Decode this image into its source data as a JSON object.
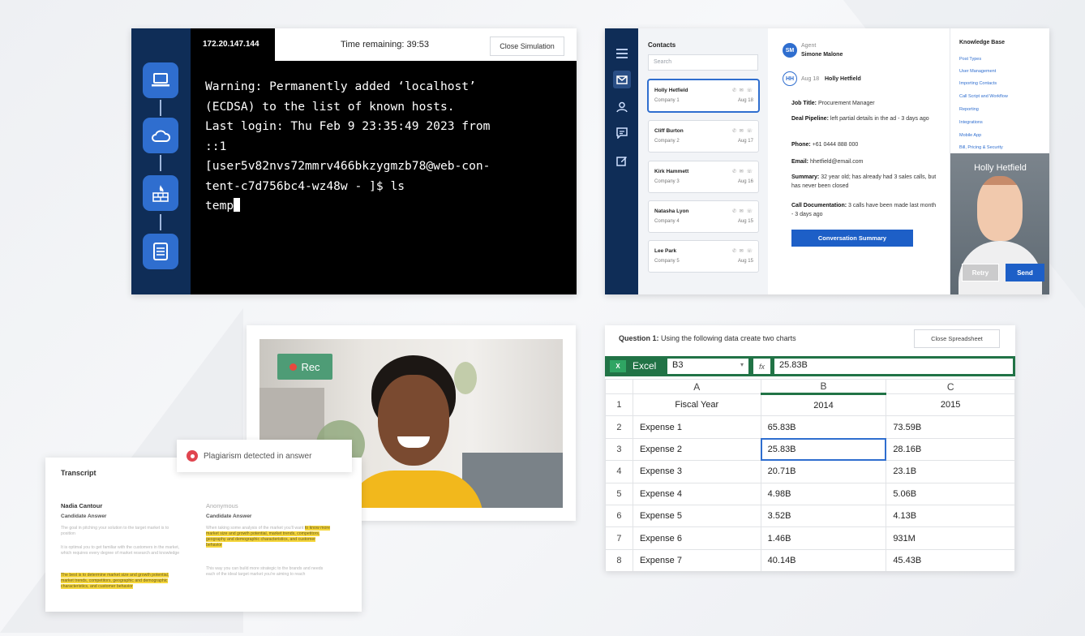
{
  "terminal": {
    "ip": "172.20.147.144",
    "time_remaining": "Time remaining: 39:53",
    "close_label": "Close Simulation",
    "lines": [
      "Warning: Permanently added ‘localhost’",
      "(ECDSA) to the list of known hosts.",
      "Last login: Thu Feb 9 23:35:49 2023 from",
      "::1",
      "[user5v82nvs72mmrv466bkzygmzb78@web-con-",
      "tent-c7d756bc4-wz48w - ]$ ls",
      "temp"
    ],
    "sidebar_icons": [
      "laptop-icon",
      "cloud-icon",
      "firewall-icon",
      "server-icon"
    ]
  },
  "crm": {
    "contacts_title": "Contacts",
    "search_placeholder": "Search",
    "contacts": [
      {
        "name": "Holly Hetfield",
        "company": "Company 1",
        "date": "Aug 18"
      },
      {
        "name": "Cliff Burton",
        "company": "Company 2",
        "date": "Aug 17"
      },
      {
        "name": "Kirk Hammett",
        "company": "Company 3",
        "date": "Aug 16"
      },
      {
        "name": "Natasha Lyon",
        "company": "Company 4",
        "date": "Aug 15"
      },
      {
        "name": "Lee Park",
        "company": "Company 5",
        "date": "Aug 15"
      }
    ],
    "agent_label": "Agent",
    "agent_name": "Simone Malone",
    "agent_initials": "SM",
    "contact_initials": "HH",
    "thread_date": "Aug 18",
    "thread_name": "Holly Hetfield",
    "job_title_label": "Job Title:",
    "job_title": "Procurement Manager",
    "deal_label": "Deal Pipeline:",
    "deal": "left partial details in the ad - 3 days ago",
    "phone_label": "Phone:",
    "phone": "+61 0444 888 000",
    "email_label": "Email:",
    "email": "hhetfield@email.com",
    "summary_label": "Summary:",
    "summary": "32 year old; has already had 3 sales calls, but has never been closed",
    "calldoc_label": "Call Documentation:",
    "calldoc": "3 calls have been made last month - 3 days ago",
    "conversation_button": "Conversation Summary",
    "kb_title": "Knowledge Base",
    "kb_links": [
      "Post Types",
      "User Management",
      "Importing Contacts",
      "Call Script and Workflow",
      "Reporting",
      "Integrations",
      "Mobile App",
      "Bill, Pricing & Security"
    ],
    "video_name": "Holly Hetfield",
    "retry": "Retry",
    "send": "Send"
  },
  "video": {
    "rec_label": "Rec"
  },
  "transcript": {
    "title": "Transcript",
    "left_name": "Nadia Cantour",
    "left_sub": "Candidate Answer",
    "left_p1": "The goal in pitching your solution to the target market is to position",
    "left_p2": "It is optimal you to get familiar with the customers in the market, which requires every degree of market research and knowledge",
    "left_hl": "The best is to determine market size and growth potential, market trends, competitors, geographic and demographic characteristics, and customer behavior",
    "right_name": "Anonymous",
    "right_sub": "Candidate Answer",
    "right_p1": "When taking some analysis of the market you'll want",
    "right_hl": "to know more market size and growth potential, market trends, competitors, geography and demographic characteristics, and customer behavior",
    "right_p2": "This way you can build more strategic to the brands and needs each of the ideal target market you're aiming to reach",
    "plagiarism": "Plagiarism detected in answer"
  },
  "sheet": {
    "question_label": "Question 1:",
    "question_text": "Using the following data create two charts",
    "close_label": "Close Spreadsheet",
    "app_name": "Excel",
    "cell_ref": "B3",
    "fx": "fx",
    "formula": "25.83B",
    "col_headers": [
      "A",
      "B",
      "C"
    ],
    "header_row": {
      "n": "1",
      "a": "Fiscal Year",
      "b": "2014",
      "c": "2015"
    },
    "rows": [
      {
        "n": "2",
        "a": "Expense 1",
        "b": "65.83B",
        "c": "73.59B"
      },
      {
        "n": "3",
        "a": "Expense 2",
        "b": "25.83B",
        "c": "28.16B"
      },
      {
        "n": "4",
        "a": "Expense 3",
        "b": "20.71B",
        "c": "23.1B"
      },
      {
        "n": "5",
        "a": "Expense 4",
        "b": "4.98B",
        "c": "5.06B"
      },
      {
        "n": "6",
        "a": "Expense 5",
        "b": "3.52B",
        "c": "4.13B"
      },
      {
        "n": "7",
        "a": "Expense 6",
        "b": "1.46B",
        "c": "931M"
      },
      {
        "n": "8",
        "a": "Expense 7",
        "b": "40.14B",
        "c": "45.43B"
      }
    ]
  }
}
